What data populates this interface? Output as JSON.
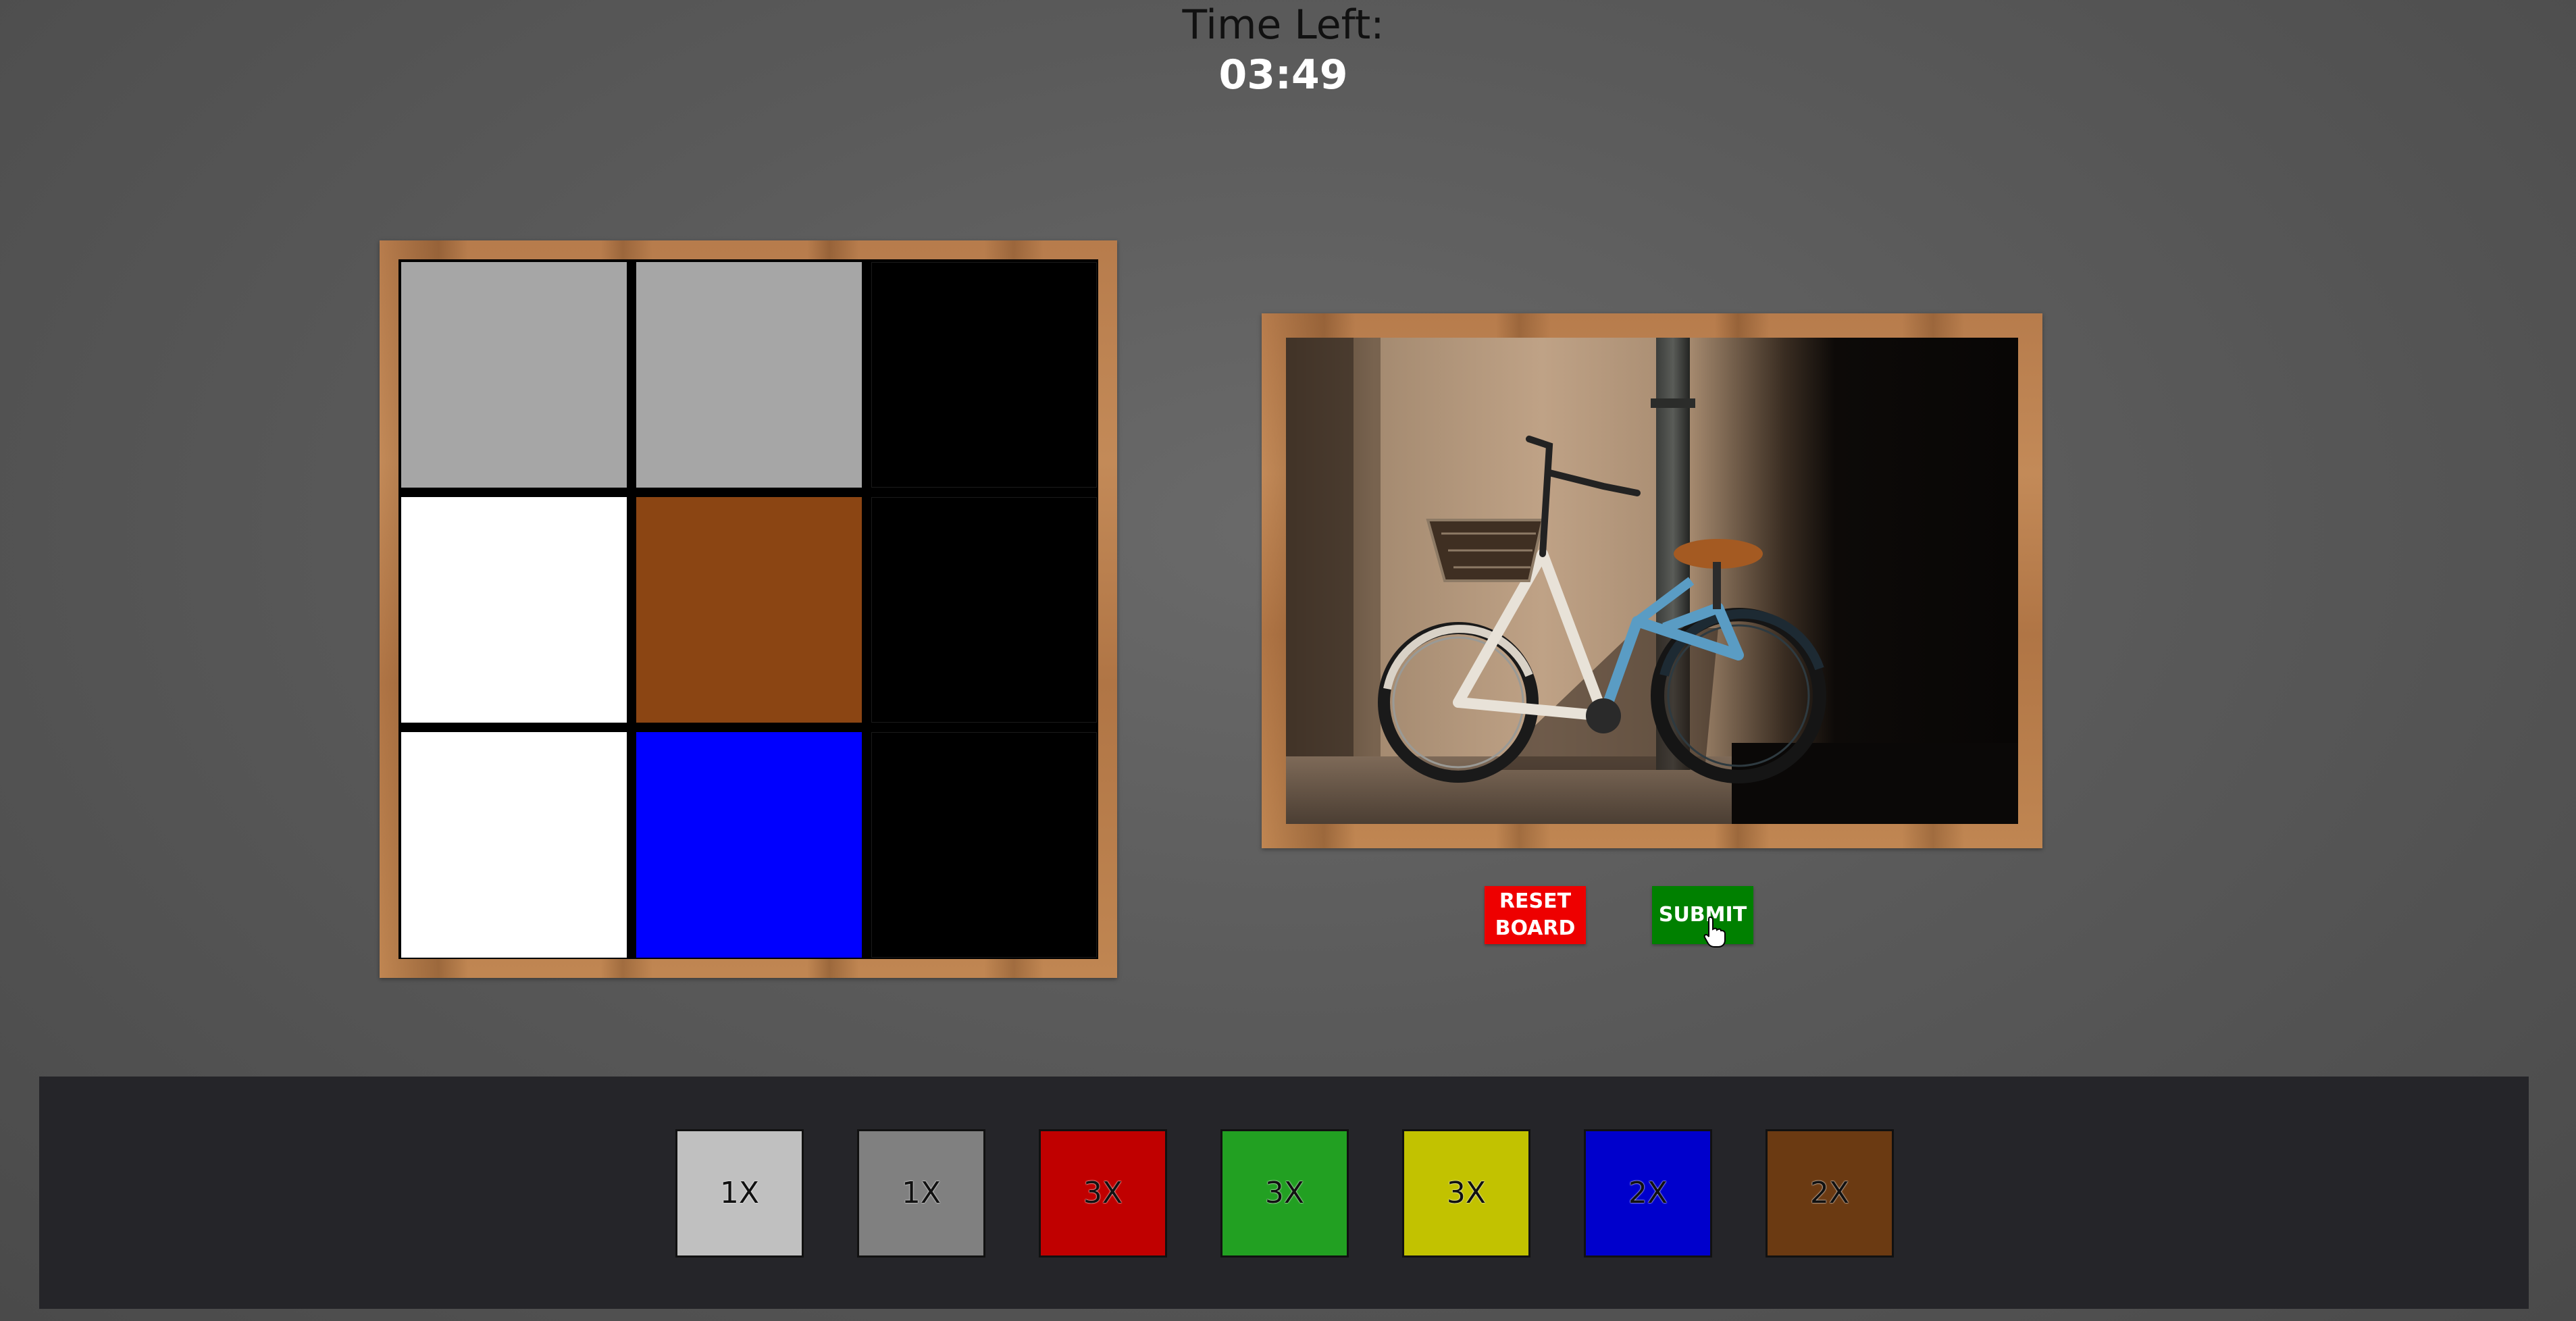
{
  "timer": {
    "label": "Time Left:",
    "value": "03:49"
  },
  "board": {
    "cells": [
      {
        "row": 0,
        "col": 0,
        "color": "#a6a6a6",
        "name": "board-cell-r1c1"
      },
      {
        "row": 0,
        "col": 1,
        "color": "#a6a6a6",
        "name": "board-cell-r1c2"
      },
      {
        "row": 0,
        "col": 2,
        "color": "#000000",
        "name": "board-cell-r1c3"
      },
      {
        "row": 1,
        "col": 0,
        "color": "#ffffff",
        "name": "board-cell-r2c1"
      },
      {
        "row": 1,
        "col": 1,
        "color": "#8b4513",
        "name": "board-cell-r2c2"
      },
      {
        "row": 1,
        "col": 2,
        "color": "#000000",
        "name": "board-cell-r2c3"
      },
      {
        "row": 2,
        "col": 0,
        "color": "#ffffff",
        "name": "board-cell-r3c1"
      },
      {
        "row": 2,
        "col": 1,
        "color": "#0000ff",
        "name": "board-cell-r3c2"
      },
      {
        "row": 2,
        "col": 2,
        "color": "#000000",
        "name": "board-cell-r3c3"
      }
    ]
  },
  "buttons": {
    "reset_label": "RESET\nBOARD",
    "submit_label": "SUBMIT",
    "reset_color": "#ee0000",
    "submit_color": "#008000"
  },
  "palette": [
    {
      "label": "1X",
      "color": "#c0c0c0",
      "name": "palette-light-gray-1x"
    },
    {
      "label": "1X",
      "color": "#808080",
      "name": "palette-gray-1x"
    },
    {
      "label": "3X",
      "color": "#c00000",
      "name": "palette-red-3x"
    },
    {
      "label": "3X",
      "color": "#22a022",
      "name": "palette-green-3x"
    },
    {
      "label": "3X",
      "color": "#c2c200",
      "name": "palette-yellow-3x"
    },
    {
      "label": "2X",
      "color": "#0000cc",
      "name": "palette-blue-2x"
    },
    {
      "label": "2X",
      "color": "#6b3a12",
      "name": "palette-brown-2x"
    }
  ]
}
